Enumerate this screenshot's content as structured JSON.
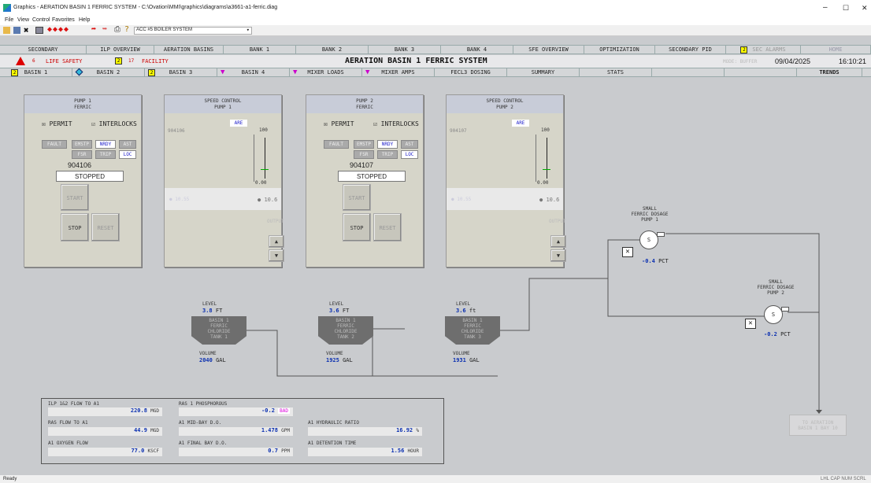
{
  "window": {
    "title": "Graphics - AERATION BASIN 1 FERRIC SYSTEM - C:\\Ovation\\MMI\\graphics\\diagrams\\a3661-a1-ferric.diag",
    "min": "–",
    "max": "☐",
    "close": "✕"
  },
  "menu": [
    "File",
    "View",
    "Control",
    "Favorites",
    "Help"
  ],
  "toolbar": {
    "system": "ACC #5 BOILER SYSTEM"
  },
  "nav1": [
    "SECONDARY",
    "ILP OVERVIEW",
    "AERATION BASINS",
    "BANK 1",
    "BANK 2",
    "BANK 3",
    "BANK 4",
    "SFE OVERVIEW",
    "OPTIMIZATION",
    "SECONDARY PID",
    "SEC ALARMS",
    "HOME"
  ],
  "alarm": {
    "life_count": "6",
    "life_label": "LIFE SAFETY",
    "fac_count": "17",
    "fac_label": "FACILITY",
    "title": "AERATION BASIN 1 FERRIC SYSTEM",
    "mode": "MODE: BUFFER",
    "date": "09/04/2025",
    "time": "16:10:21"
  },
  "nav2": [
    "BASIN 1",
    "BASIN 2",
    "BASIN 3",
    "BASIN 4",
    "MIXER LOADS",
    "MIXER AMPS",
    "FECL3 DOSING",
    "SUMMARY",
    "STATS",
    "TRENDS"
  ],
  "pumps": [
    {
      "head1": "PUMP 1",
      "head2": "FERRIC",
      "permit": "PERMIT",
      "interlocks": "INTERLOCKS",
      "fault": "FAULT",
      "emstp": "EMSTP",
      "nrdy": "NRDY",
      "ast": "AST",
      "fsr": "FSR",
      "trip": "TRIP",
      "loc": "LOC",
      "id": "904106",
      "status": "STOPPED",
      "start": "START",
      "stop": "STOP",
      "reset": "RESET"
    },
    {
      "head1": "PUMP 2",
      "head2": "FERRIC",
      "permit": "PERMIT",
      "interlocks": "INTERLOCKS",
      "fault": "FAULT",
      "emstp": "EMSTP",
      "nrdy": "NRDY",
      "ast": "AST",
      "fsr": "FSR",
      "trip": "TRIP",
      "loc": "LOC",
      "id": "904107",
      "status": "STOPPED",
      "start": "START",
      "stop": "STOP",
      "reset": "RESET"
    }
  ],
  "speed": [
    {
      "head1": "SPEED CONTROL",
      "head2": "PUMP 1",
      "mode": "ARE",
      "id": "904106",
      "top": "100",
      "bottom": "0.00",
      "sp": "10.55",
      "pv": "10.6",
      "output": "OUTPUT"
    },
    {
      "head1": "SPEED CONTROL",
      "head2": "PUMP 2",
      "mode": "ARE",
      "id": "904107",
      "top": "100",
      "bottom": "0.00",
      "sp": "10.55",
      "pv": "10.6",
      "output": "OUTPUT"
    }
  ],
  "tanks": [
    {
      "level_label": "LEVEL",
      "level": "3.8",
      "level_unit": "FT",
      "name": [
        "BASIN 1",
        "FERRIC",
        "CHLORIDE",
        "TANK 1"
      ],
      "vol_label": "VOLUME",
      "vol": "2040",
      "vol_unit": "GAL"
    },
    {
      "level_label": "LEVEL",
      "level": "3.6",
      "level_unit": "FT",
      "name": [
        "BASIN 1",
        "FERRIC",
        "CHLORIDE",
        "TANK 2"
      ],
      "vol_label": "VOLUME",
      "vol": "1925",
      "vol_unit": "GAL"
    },
    {
      "level_label": "LEVEL",
      "level": "3.6",
      "level_unit": "ft",
      "name": [
        "BASIN 1",
        "FERRIC",
        "CHLORIDE",
        "TANK 3"
      ],
      "vol_label": "VOLUME",
      "vol": "1931",
      "vol_unit": "GAL"
    }
  ],
  "dosing": [
    {
      "name": [
        "SMALL",
        "FERRIC DOSAGE",
        "PUMP 1"
      ],
      "value": "-0.4",
      "unit": "PCT"
    },
    {
      "name": [
        "SMALL",
        "FERRIC DOSAGE",
        "PUMP 2"
      ],
      "value": "-0.2",
      "unit": "PCT"
    }
  ],
  "dest": [
    "TO AERATION",
    "BASIN 1 BAY 10"
  ],
  "stats": {
    "ilp_flow": {
      "label": "ILP 1&2 FLOW TO A1",
      "value": "220.8",
      "unit": "MGD"
    },
    "ras_flow": {
      "label": "RAS FLOW TO A1",
      "value": "44.9",
      "unit": "MGD"
    },
    "oxygen": {
      "label": "A1 OXYGEN FLOW",
      "value": "77.0",
      "unit": "KSCF"
    },
    "phos": {
      "label": "RAS 1 PHOSPHOROUS",
      "value": "-0.2",
      "unit": "BAD"
    },
    "midbay": {
      "label": "A1 MID-BAY D.O.",
      "value": "1.478",
      "unit": "GPM"
    },
    "finalbay": {
      "label": "A1 FINAL BAY D.O.",
      "value": "0.7",
      "unit": "PPM"
    },
    "hydraulic": {
      "label": "A1 HYDRAULIC RATIO",
      "value": "16.92",
      "unit": "%"
    },
    "detention": {
      "label": "A1 DETENTION TIME",
      "value": "1.56",
      "unit": "HOUR"
    }
  },
  "status": {
    "left": "Ready",
    "right": "LHL CAP NUM SCRL"
  }
}
